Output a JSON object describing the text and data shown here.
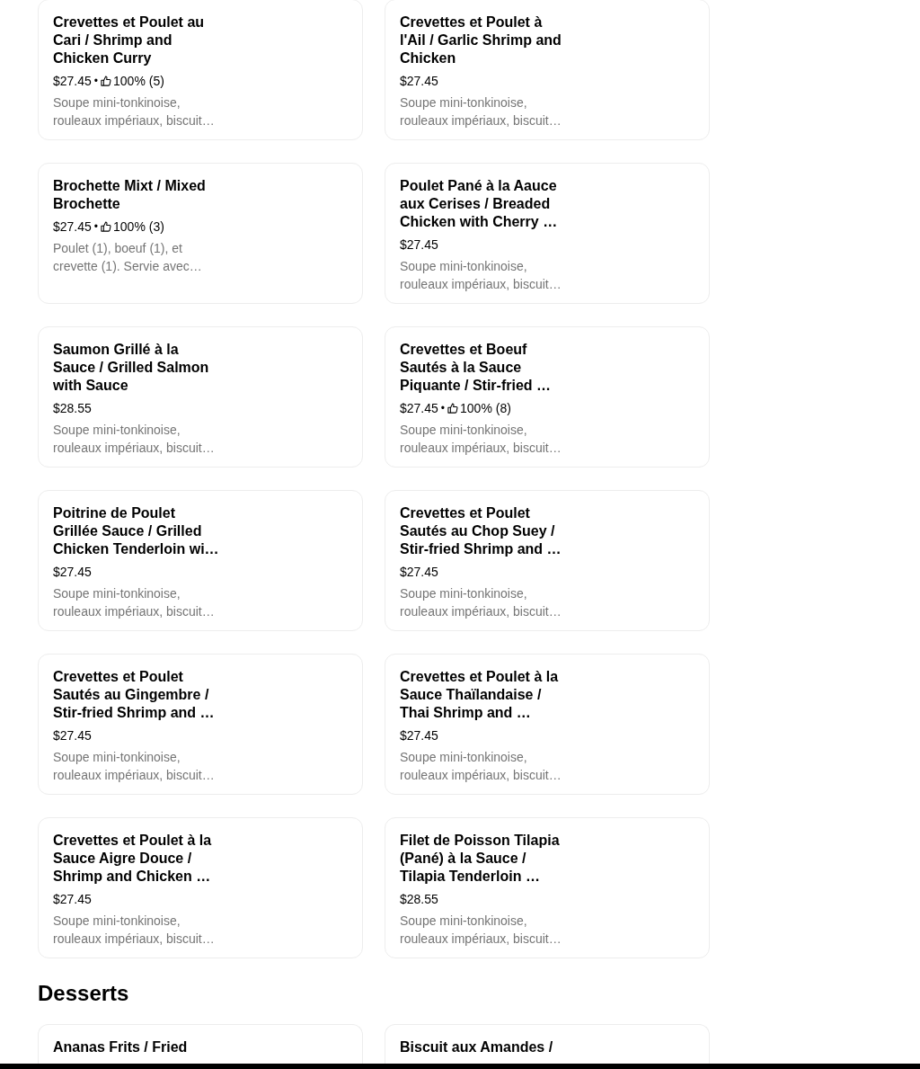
{
  "sections": [
    {
      "items": [
        {
          "name": "Crevettes et Poulet au Cari / Shrimp and Chicken Curry",
          "price": "$27.45",
          "separator": "•",
          "rating": "100% (5)",
          "description": "Soupe mini-tonkinoise, rouleaux impériaux, biscuit…"
        },
        {
          "name": "Crevettes et Poulet à l'Ail / Garlic Shrimp and Chicken",
          "price": "$27.45",
          "description": "Soupe mini-tonkinoise, rouleaux impériaux, biscuit…"
        },
        {
          "name": "Brochette Mixt / Mixed Brochette",
          "price": "$27.45",
          "separator": "•",
          "rating": "100% (3)",
          "description": "Poulet (1), boeuf (1), et crevette (1). Servie avec…"
        },
        {
          "name": "Poulet Pané à la Aauce aux Cerises / Breaded Chicken with Cherry …",
          "price": "$27.45",
          "description": "Soupe mini-tonkinoise, rouleaux impériaux, biscuit…"
        },
        {
          "name": "Saumon Grillé à la Sauce / Grilled Salmon with Sauce",
          "price": "$28.55",
          "description": "Soupe mini-tonkinoise, rouleaux impériaux, biscuit…"
        },
        {
          "name": "Crevettes et Boeuf Sautés à la Sauce Piquante / Stir-fried …",
          "price": "$27.45",
          "separator": "•",
          "rating": "100% (8)",
          "description": "Soupe mini-tonkinoise, rouleaux impériaux, biscuit…"
        },
        {
          "name": "Poitrine de Poulet Grillée Sauce / Grilled Chicken Tenderloin wi…",
          "price": "$27.45",
          "description": "Soupe mini-tonkinoise, rouleaux impériaux, biscuit…"
        },
        {
          "name": "Crevettes et Poulet Sautés au Chop Suey / Stir-fried Shrimp and …",
          "price": "$27.45",
          "description": "Soupe mini-tonkinoise, rouleaux impériaux, biscuit…"
        },
        {
          "name": "Crevettes et Poulet Sautés au Gingembre / Stir-fried Shrimp and …",
          "price": "$27.45",
          "description": "Soupe mini-tonkinoise, rouleaux impériaux, biscuit…"
        },
        {
          "name": "Crevettes et Poulet à la Sauce Thaïlandaise / Thai Shrimp and …",
          "price": "$27.45",
          "description": "Soupe mini-tonkinoise, rouleaux impériaux, biscuit…"
        },
        {
          "name": "Crevettes et Poulet à la Sauce Aigre Douce / Shrimp and Chicken …",
          "price": "$27.45",
          "description": "Soupe mini-tonkinoise, rouleaux impériaux, biscuit…"
        },
        {
          "name": "Filet de Poisson Tilapia (Pané) à la Sauce / Tilapia Tenderloin …",
          "price": "$28.55",
          "description": "Soupe mini-tonkinoise, rouleaux impériaux, biscuit…"
        }
      ]
    },
    {
      "title": "Desserts",
      "items": [
        {
          "name": "Ananas Frits / Fried"
        },
        {
          "name": "Biscuit aux Amandes /"
        }
      ]
    }
  ]
}
